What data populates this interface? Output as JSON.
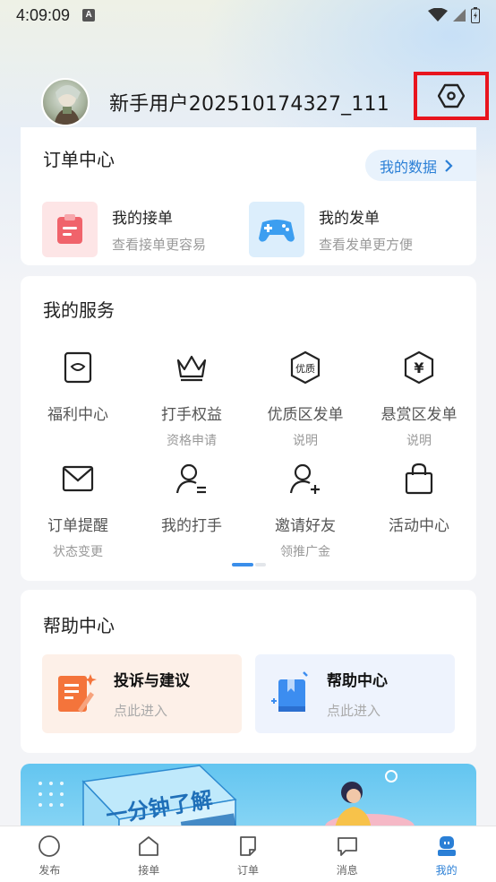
{
  "status_bar": {
    "time": "4:09:09",
    "notif_letter": "A"
  },
  "profile": {
    "username": "新手用户202510174327_111"
  },
  "order_center": {
    "title": "订单中心",
    "my_data_label": "我的数据",
    "items": [
      {
        "title": "我的接单",
        "subtitle": "查看接单更容易"
      },
      {
        "title": "我的发单",
        "subtitle": "查看发单更方便"
      }
    ]
  },
  "services": {
    "title": "我的服务",
    "items": [
      {
        "label": "福利中心",
        "sub": ""
      },
      {
        "label": "打手权益",
        "sub": "资格申请"
      },
      {
        "label": "优质区发单",
        "sub": "说明",
        "icon_text": "优质"
      },
      {
        "label": "悬赏区发单",
        "sub": "说明",
        "icon_text": "¥"
      },
      {
        "label": "订单提醒",
        "sub": "状态变更"
      },
      {
        "label": "我的打手",
        "sub": ""
      },
      {
        "label": "邀请好友",
        "sub": "领推广金"
      },
      {
        "label": "活动中心",
        "sub": ""
      }
    ]
  },
  "help_center": {
    "title": "帮助中心",
    "items": [
      {
        "title": "投诉与建议",
        "subtitle": "点此进入"
      },
      {
        "title": "帮助中心",
        "subtitle": "点此进入"
      }
    ]
  },
  "banner": {
    "text": "一分钟了解"
  },
  "tabbar": {
    "items": [
      {
        "label": "发布"
      },
      {
        "label": "接单"
      },
      {
        "label": "订单"
      },
      {
        "label": "消息"
      },
      {
        "label": "我的"
      }
    ],
    "active_index": 4
  },
  "colors": {
    "accent": "#2a7fd6",
    "highlight_box": "#e8141e"
  }
}
